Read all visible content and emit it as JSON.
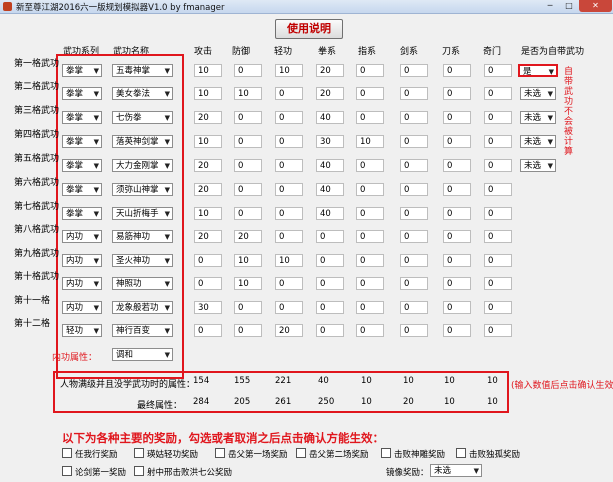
{
  "window": {
    "title": "新至尊江湖2016六一版规划模拟器V1.0 by fmanager",
    "min": "─",
    "max": "□",
    "close": "✕"
  },
  "help_button": "使用说明",
  "headers": {
    "school": "武功系列",
    "skill": "武功名称",
    "stats": [
      "攻击",
      "防御",
      "轻功",
      "拳系",
      "指系",
      "剑系",
      "刀系",
      "奇门"
    ],
    "self_skill": "是否为自带武功"
  },
  "rows": [
    {
      "label": "第一格武功",
      "school": "拳掌",
      "skill": "五毒神掌",
      "values": [
        "10",
        "0",
        "10",
        "20",
        "0",
        "0",
        "0",
        "0"
      ],
      "flag": "是"
    },
    {
      "label": "第二格武功",
      "school": "拳掌",
      "skill": "美女拳法",
      "values": [
        "10",
        "10",
        "0",
        "20",
        "0",
        "0",
        "0",
        "0"
      ],
      "flag": "未选"
    },
    {
      "label": "第三格武功",
      "school": "拳掌",
      "skill": "七伤拳",
      "values": [
        "20",
        "0",
        "0",
        "40",
        "0",
        "0",
        "0",
        "0"
      ],
      "flag": "未选"
    },
    {
      "label": "第四格武功",
      "school": "拳掌",
      "skill": "落英神剑掌",
      "values": [
        "10",
        "0",
        "0",
        "30",
        "10",
        "0",
        "0",
        "0"
      ],
      "flag": "未选"
    },
    {
      "label": "第五格武功",
      "school": "拳掌",
      "skill": "大力金刚掌",
      "values": [
        "20",
        "0",
        "0",
        "40",
        "0",
        "0",
        "0",
        "0"
      ],
      "flag": "未选"
    },
    {
      "label": "第六格武功",
      "school": "拳掌",
      "skill": "须弥山神掌",
      "values": [
        "20",
        "0",
        "0",
        "40",
        "0",
        "0",
        "0",
        "0"
      ],
      "flag": ""
    },
    {
      "label": "第七格武功",
      "school": "拳掌",
      "skill": "天山折梅手",
      "values": [
        "10",
        "0",
        "0",
        "40",
        "0",
        "0",
        "0",
        "0"
      ],
      "flag": ""
    },
    {
      "label": "第八格武功",
      "school": "内功",
      "skill": "易筋神功",
      "values": [
        "20",
        "20",
        "0",
        "0",
        "0",
        "0",
        "0",
        "0"
      ],
      "flag": ""
    },
    {
      "label": "第九格武功",
      "school": "内功",
      "skill": "圣火神功",
      "values": [
        "0",
        "10",
        "10",
        "0",
        "0",
        "0",
        "0",
        "0"
      ],
      "flag": ""
    },
    {
      "label": "第十格武功",
      "school": "内功",
      "skill": "神照功",
      "values": [
        "0",
        "10",
        "0",
        "0",
        "0",
        "0",
        "0",
        "0"
      ],
      "flag": ""
    },
    {
      "label": "第十一格",
      "school": "内功",
      "skill": "龙象般若功",
      "values": [
        "30",
        "0",
        "0",
        "0",
        "0",
        "0",
        "0",
        "0"
      ],
      "flag": ""
    },
    {
      "label": "第十二格",
      "school": "轻功",
      "skill": "神行百变",
      "values": [
        "0",
        "0",
        "20",
        "0",
        "0",
        "0",
        "0",
        "0"
      ],
      "flag": ""
    }
  ],
  "inner_attr": {
    "label": "内功属性：",
    "value": "调和"
  },
  "side_note": "自带武功不会被计算",
  "base_row": {
    "label": "人物满级并且没学武功时的属性：",
    "values": [
      "154",
      "155",
      "221",
      "40",
      "10",
      "10",
      "10",
      "10"
    ]
  },
  "final_row": {
    "label": "最终属性：",
    "values": [
      "284",
      "205",
      "261",
      "250",
      "10",
      "20",
      "10",
      "10"
    ]
  },
  "input_note": "(输入数值后点击确认生效)",
  "rewards": {
    "title": "以下为各种主要的奖励，勾选或者取消之后点击确认方能生效：",
    "items": [
      "任我行奖励",
      "瑛姑轻功奖励",
      "岳父第一场奖励",
      "岳父第二场奖励",
      "击败神雕奖励",
      "击败独孤奖励",
      "论剑第一奖励",
      "射中邢击败洪七公奖励"
    ],
    "mirror_label": "镜像奖励：",
    "mirror_value": "未选"
  }
}
